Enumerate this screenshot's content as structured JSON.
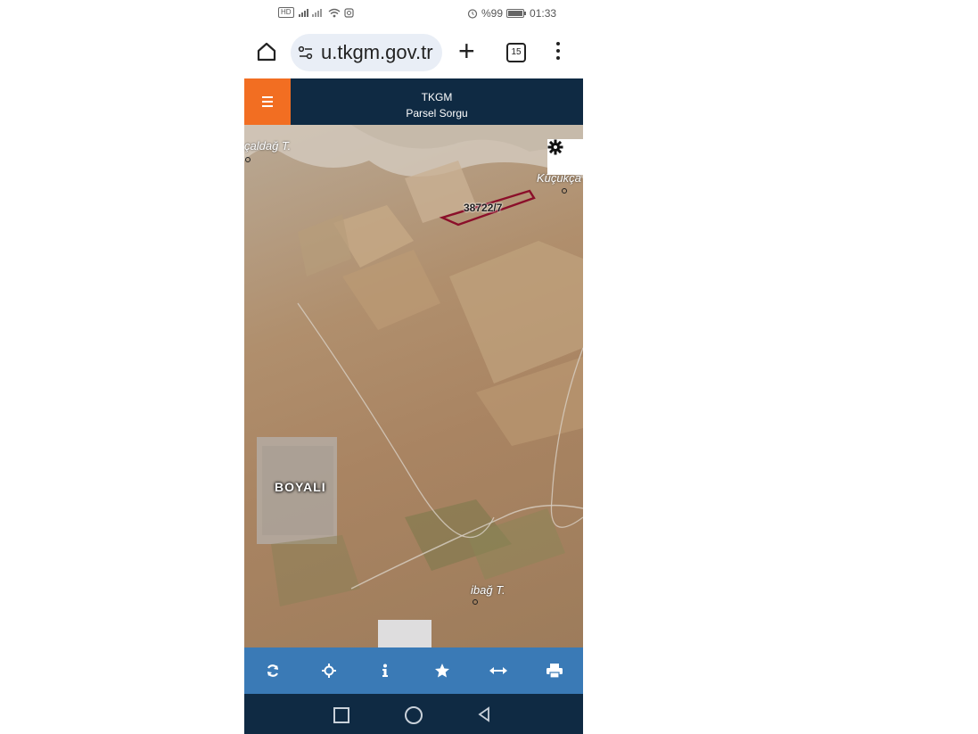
{
  "status_bar": {
    "net_chip": "HD",
    "right_text": "%99",
    "time": "01:33"
  },
  "browser": {
    "url": "u.tkgm.gov.tr",
    "tab_count": "15"
  },
  "app": {
    "title": "TKGM",
    "subtitle": "Parsel Sorgu"
  },
  "map": {
    "parcel_label": "38722/7",
    "place_top_left": "çaldağ T.",
    "place_top_right": "Küçükça",
    "town_label": "BOYALI",
    "place_bottom": "ibağ T."
  },
  "toolbar": {
    "items": [
      "refresh-icon",
      "locate-icon",
      "info-icon",
      "star-icon",
      "measure-icon",
      "print-icon"
    ]
  },
  "colors": {
    "header": "#0f2a43",
    "menu_button": "#f26e22",
    "toolbar": "#3a7ab6",
    "parcel_outline": "#8b0f2a"
  }
}
